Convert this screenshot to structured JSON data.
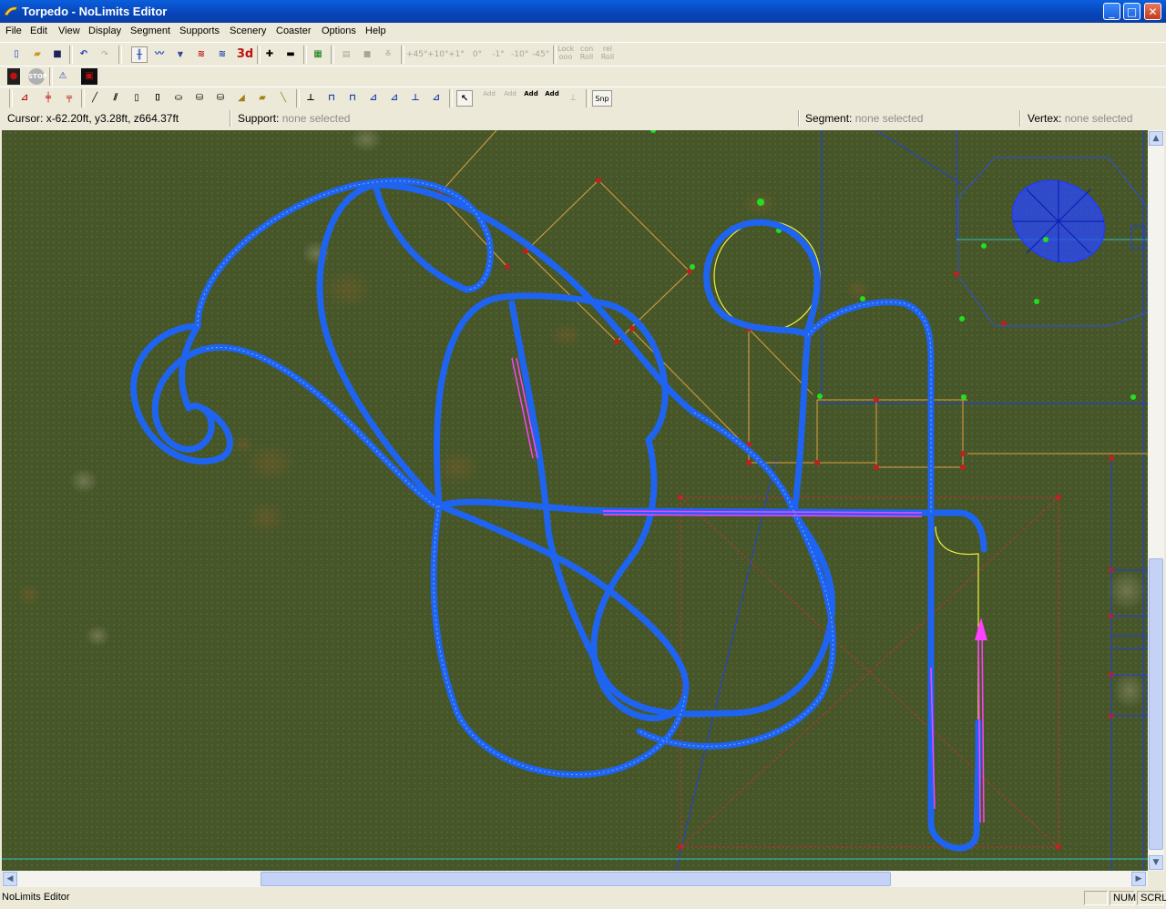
{
  "window": {
    "title": "Torpedo - NoLimits Editor",
    "minimize": "_",
    "maximize": "□",
    "close": "✕"
  },
  "menu": [
    "File",
    "Edit",
    "View",
    "Display",
    "Segment",
    "Supports",
    "Scenery",
    "Coaster",
    "Options",
    "Help"
  ],
  "toolbar1": {
    "threed_label": "3d",
    "angles": [
      "+45°",
      "+10°",
      "+1°",
      "0°",
      "-1°",
      "-10°",
      "-45°"
    ],
    "lock_label": "Lock",
    "lock_sub": "ooo",
    "con_roll_label": "con",
    "con_roll_sub": "Roll",
    "rel_roll_label": "rel",
    "rel_roll_sub": "Roll"
  },
  "toolbar2": {
    "stop_label": "STOP"
  },
  "toolbar3": {
    "add_labels": [
      "Add",
      "Add",
      "Add",
      "Add"
    ],
    "snap_label": "Snp"
  },
  "status": {
    "cursor_label": "Cursor:",
    "cursor_value": "x-62.20ft, y3.28ft, z664.37ft",
    "support_label": "Support:",
    "support_value": "none selected",
    "segment_label": "Segment:",
    "segment_value": "none selected",
    "vertex_label": "Vertex:",
    "vertex_value": "none selected"
  },
  "bottom": {
    "app_name": "NoLimits Editor",
    "num": "NUM",
    "scrl": "SCRL"
  },
  "colors": {
    "track": "#1e64f0",
    "rail": "#ffff40",
    "ground": "#4a5a2a",
    "support": "#e0a040",
    "selection": "#ff40ff"
  }
}
